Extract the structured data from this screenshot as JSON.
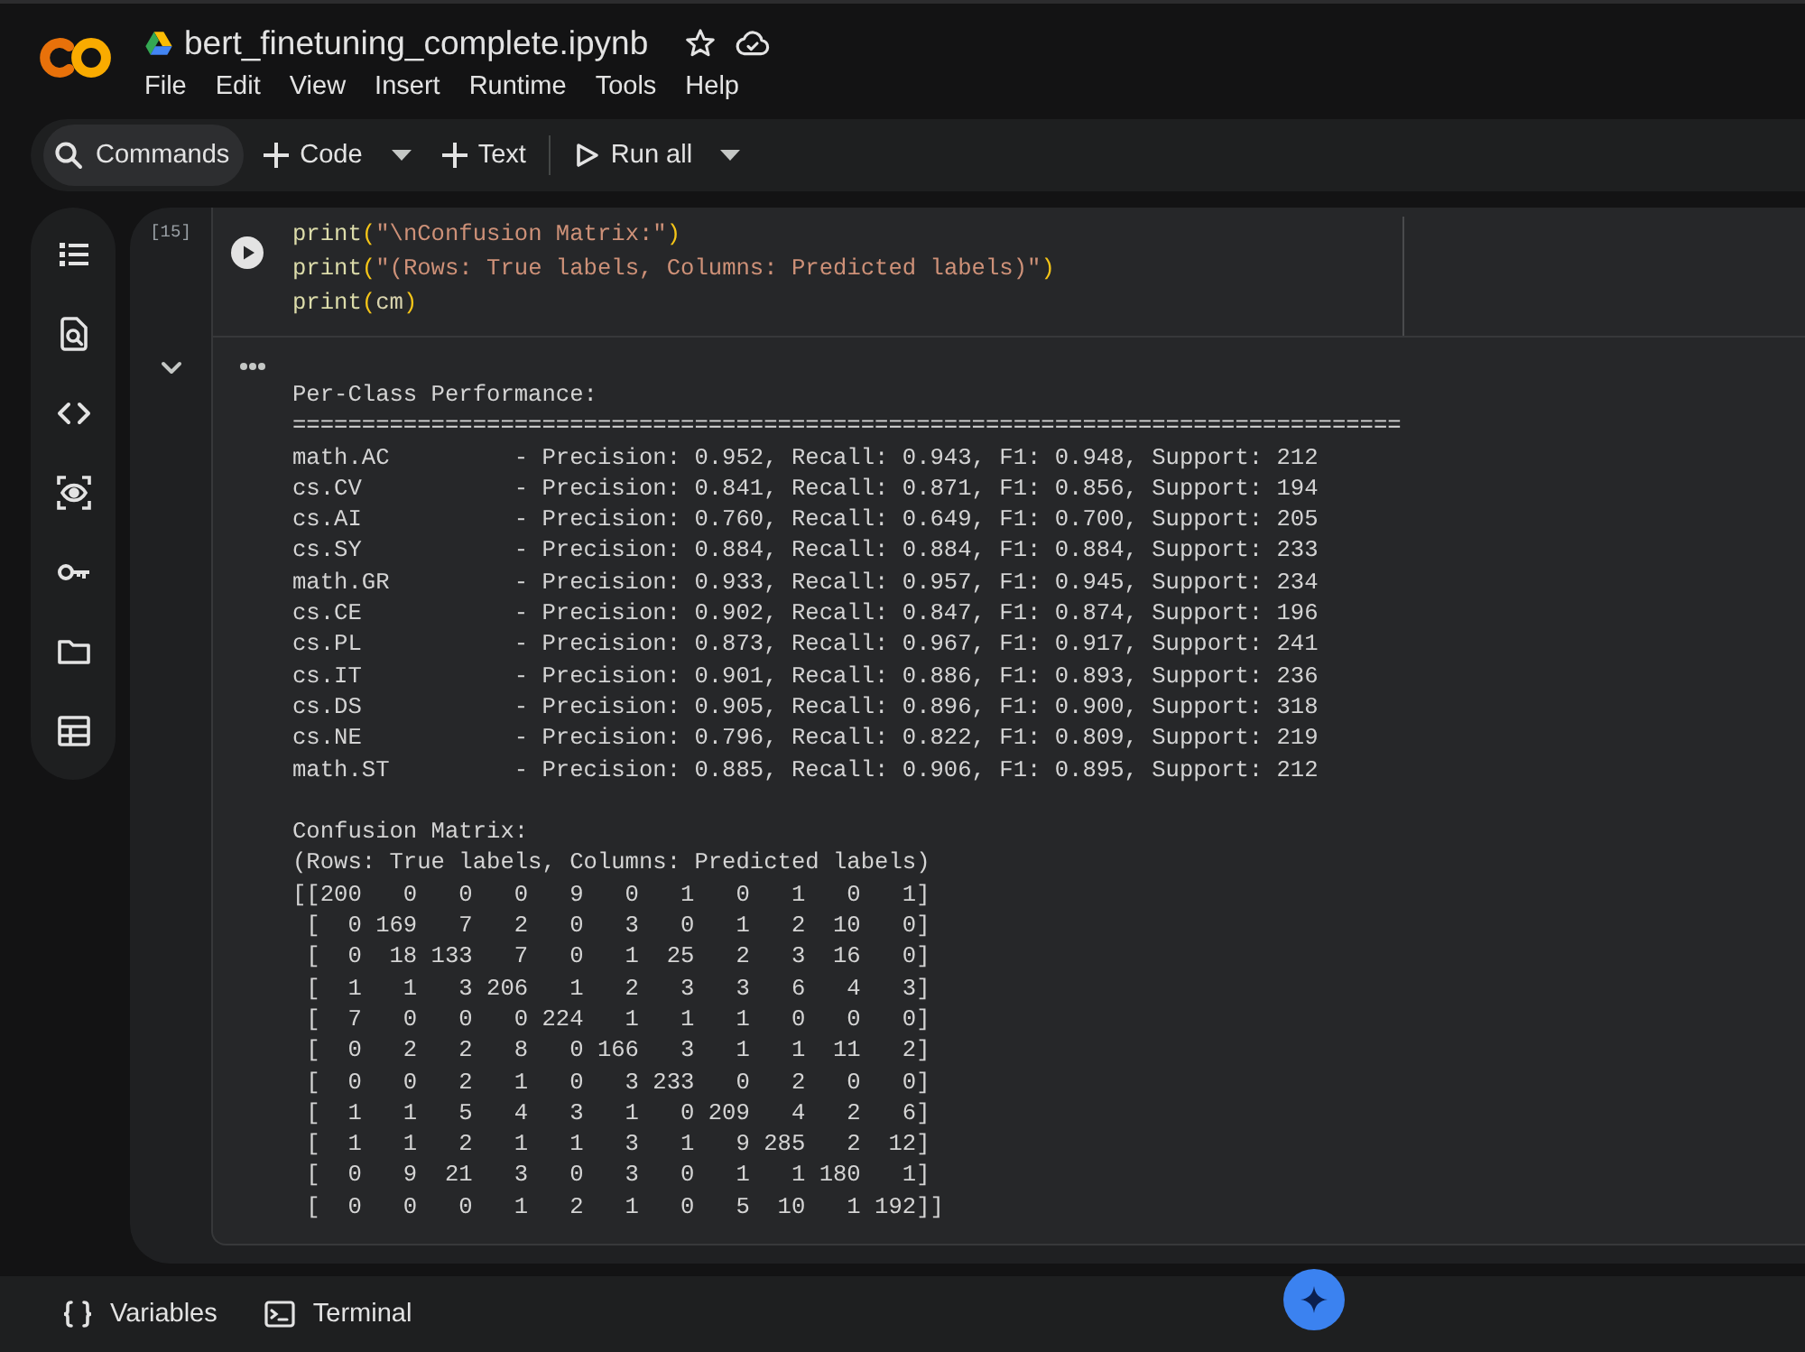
{
  "header": {
    "title": "bert_finetuning_complete.ipynb",
    "menu": [
      "File",
      "Edit",
      "View",
      "Insert",
      "Runtime",
      "Tools",
      "Help"
    ]
  },
  "toolbar": {
    "commands": "Commands",
    "add_code": "Code",
    "add_text": "Text",
    "run_all": "Run all"
  },
  "cell": {
    "execution_count": "[15]",
    "code": [
      {
        "tokens": [
          {
            "kind": "function",
            "text": "print"
          },
          {
            "kind": "bracket",
            "text": "("
          },
          {
            "kind": "string",
            "text": "\"\\nConfusion Matrix:\""
          },
          {
            "kind": "bracket",
            "text": ")"
          }
        ]
      },
      {
        "tokens": [
          {
            "kind": "function",
            "text": "print"
          },
          {
            "kind": "bracket",
            "text": "("
          },
          {
            "kind": "string",
            "text": "\"(Rows: True labels, Columns: Predicted labels)\""
          },
          {
            "kind": "bracket",
            "text": ")"
          }
        ]
      },
      {
        "tokens": [
          {
            "kind": "function",
            "text": "print"
          },
          {
            "kind": "bracket",
            "text": "("
          },
          {
            "kind": "variable",
            "text": "cm"
          },
          {
            "kind": "bracket",
            "text": ")"
          }
        ]
      }
    ],
    "output": [
      {
        "lines": [
          "Per-Class Performance:",
          "================================================================================",
          "math.AC         - Precision: 0.952, Recall: 0.943, F1: 0.948, Support: 212",
          "cs.CV           - Precision: 0.841, Recall: 0.871, F1: 0.856, Support: 194",
          "cs.AI           - Precision: 0.760, Recall: 0.649, F1: 0.700, Support: 205",
          "cs.SY           - Precision: 0.884, Recall: 0.884, F1: 0.884, Support: 233",
          "math.GR         - Precision: 0.933, Recall: 0.957, F1: 0.945, Support: 234",
          "cs.CE           - Precision: 0.902, Recall: 0.847, F1: 0.874, Support: 196",
          "cs.PL           - Precision: 0.873, Recall: 0.967, F1: 0.917, Support: 241",
          "cs.IT           - Precision: 0.901, Recall: 0.886, F1: 0.893, Support: 236",
          "cs.DS           - Precision: 0.905, Recall: 0.896, F1: 0.900, Support: 318",
          "cs.NE           - Precision: 0.796, Recall: 0.822, F1: 0.809, Support: 219",
          "math.ST         - Precision: 0.885, Recall: 0.906, F1: 0.895, Support: 212"
        ]
      },
      {
        "lines": [
          "Confusion Matrix:",
          "(Rows: True labels, Columns: Predicted labels)",
          "[[200   0   0   0   9   0   1   0   1   0   1]",
          " [  0 169   7   2   0   3   0   1   2  10   0]",
          " [  0  18 133   7   0   1  25   2   3  16   0]",
          " [  1   1   3 206   1   2   3   3   6   4   3]",
          " [  7   0   0   0 224   1   1   1   0   0   0]",
          " [  0   2   2   8   0 166   3   1   1  11   2]",
          " [  0   0   2   1   0   3 233   0   2   0   0]",
          " [  1   1   5   4   3   1   0 209   4   2   6]",
          " [  1   1   2   1   1   3   1   9 285   2  12]",
          " [  0   9  21   3   0   3   0   1   1 180   1]",
          " [  0   0   0   1   2   1   0   5  10   1 192]]"
        ]
      }
    ]
  },
  "bottom_bar": {
    "items": [
      {
        "kind": "variables",
        "label": "Variables"
      },
      {
        "kind": "terminal",
        "label": "Terminal"
      }
    ]
  }
}
